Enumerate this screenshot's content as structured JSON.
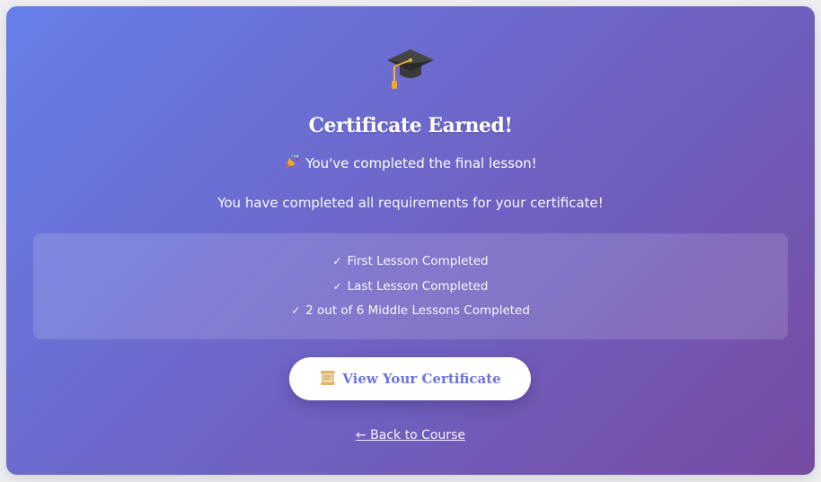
{
  "header": {
    "icon": "graduation-cap-icon",
    "title": "Certificate Earned!",
    "subtitle_icon": "party-popper-icon",
    "subtitle": "You've completed the final lesson!"
  },
  "intro": "You have completed all requirements for your certificate!",
  "requirements": [
    {
      "icon": "checkmark-icon",
      "label": "First Lesson Completed"
    },
    {
      "icon": "checkmark-icon",
      "label": "Last Lesson Completed"
    },
    {
      "icon": "checkmark-icon",
      "label": "2 out of 6 Middle Lessons Completed"
    }
  ],
  "certificate_button": {
    "icon": "scroll-icon",
    "label": "View Your Certificate"
  },
  "back_link": "← Back to Course",
  "colors": {
    "gradient_start": "#667eea",
    "gradient_end": "#764ba2",
    "button_text": "#6b73e0"
  }
}
